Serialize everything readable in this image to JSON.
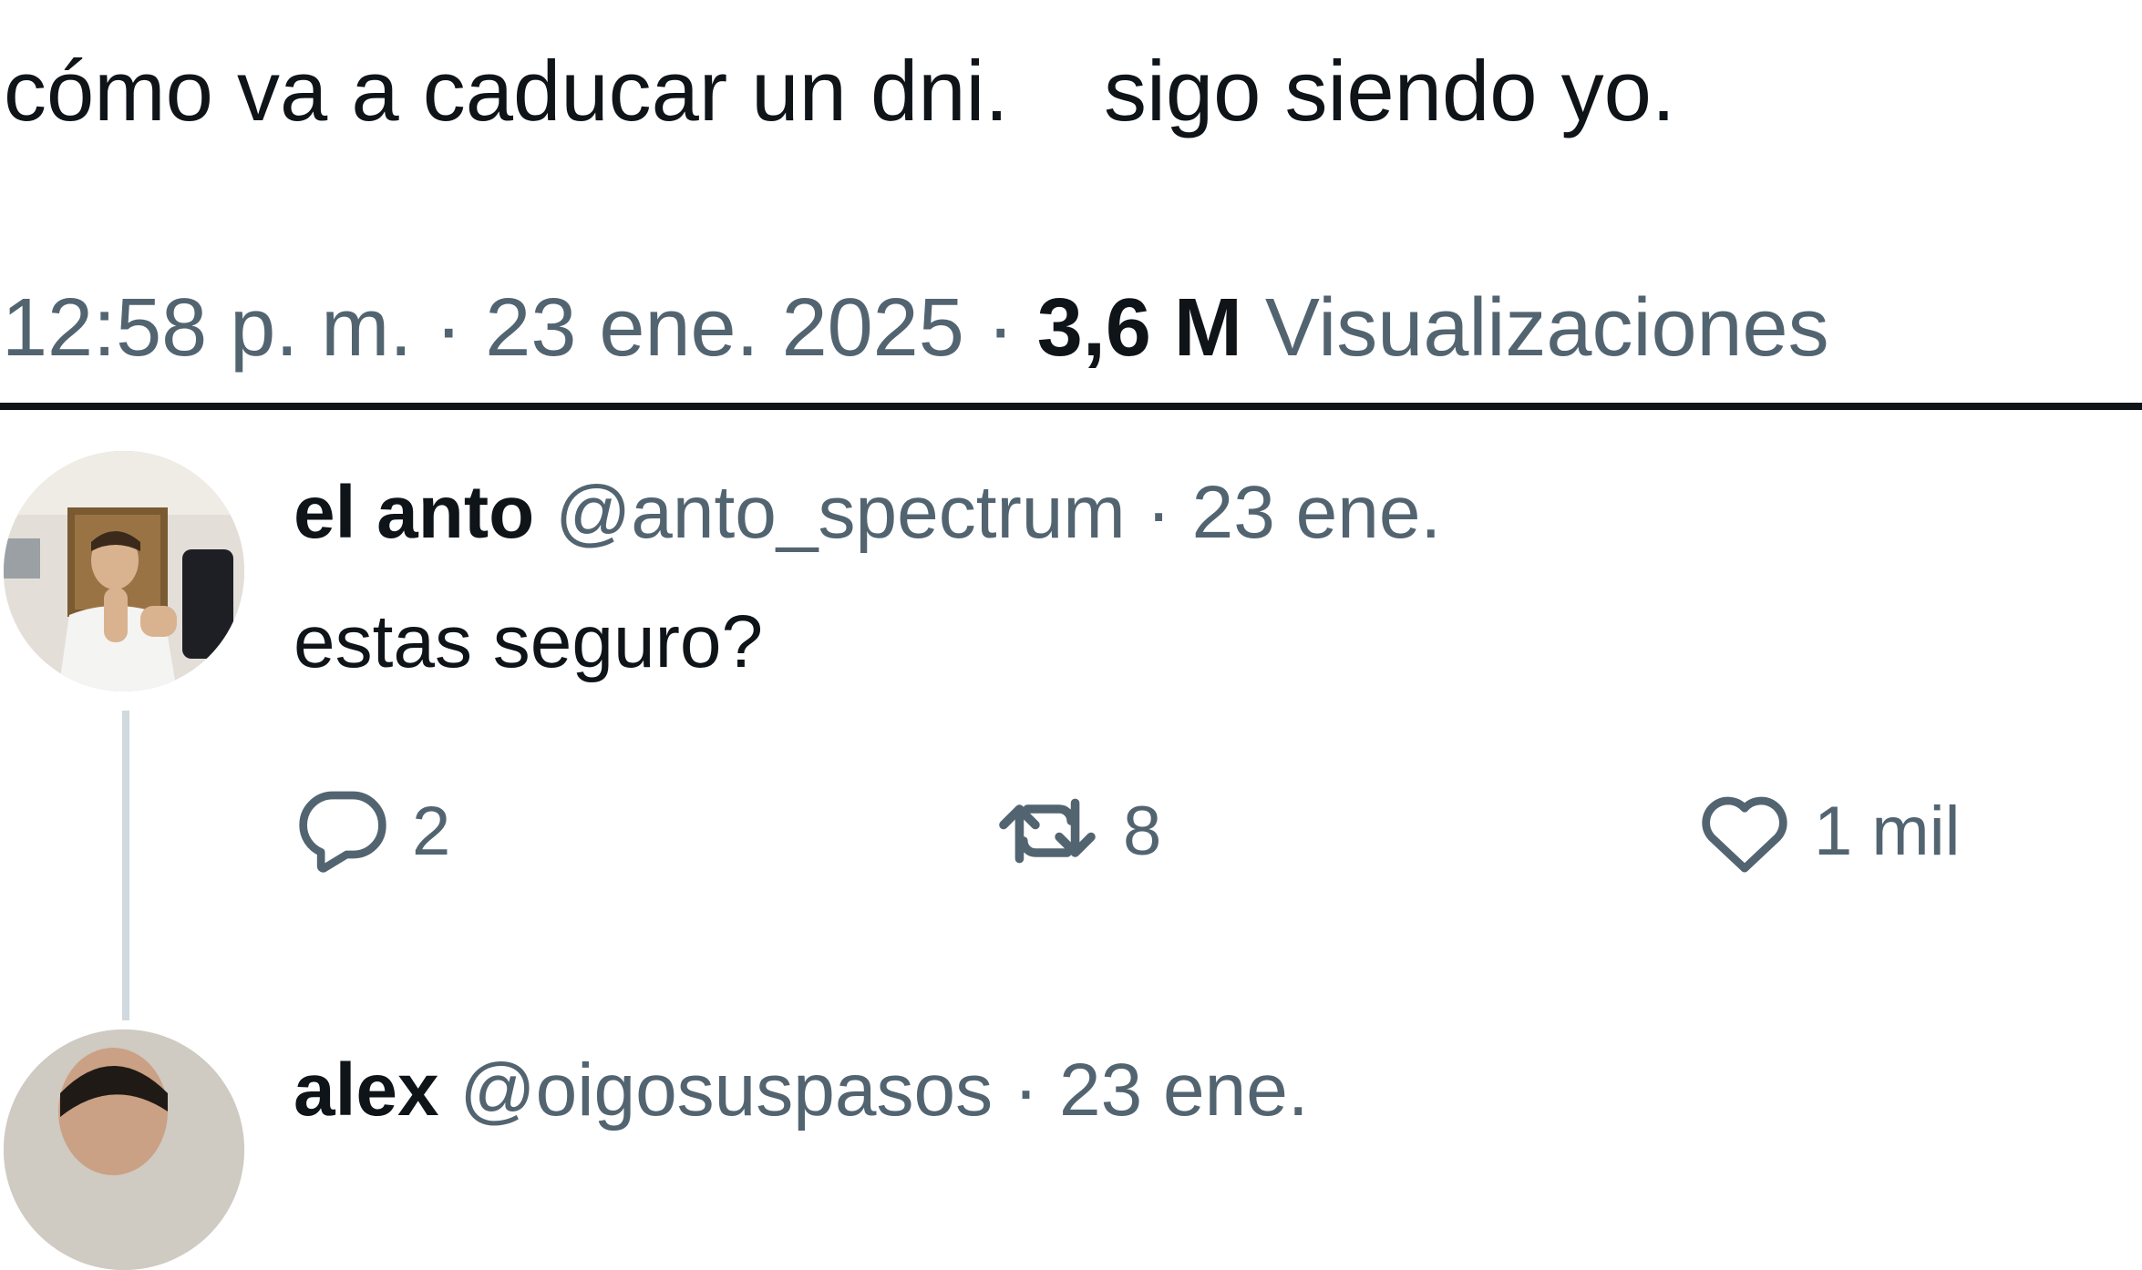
{
  "main_tweet": {
    "text": "cómo va a caducar un dni.    sigo siendo yo.",
    "time": "12:58 p. m.",
    "separator": "·",
    "date": "23 ene. 2025",
    "views_count": "3,6 M",
    "views_label": "Visualizaciones"
  },
  "replies": [
    {
      "display_name": "el anto",
      "handle": "@anto_spectrum",
      "separator": "·",
      "date": "23 ene.",
      "text": "estas seguro?",
      "reply_count": "2",
      "retweet_count": "8",
      "like_count": "1 mil",
      "icons": {
        "reply": "speech-bubble-icon",
        "retweet": "retweet-arrows-icon",
        "like": "heart-icon"
      }
    },
    {
      "display_name": "alex",
      "handle": "@oigosuspasos",
      "separator": "·",
      "date": "23 ene."
    }
  ],
  "colors": {
    "primary_text": "#0f1419",
    "secondary_text": "#536471",
    "thread_line": "#cfd9de",
    "divider": "#0f1419"
  }
}
